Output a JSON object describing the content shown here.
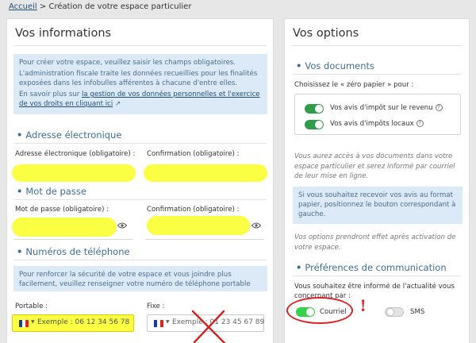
{
  "breadcrumb": {
    "home": "Accueil",
    "separator": ">",
    "current": "Création de votre espace particulier"
  },
  "left": {
    "title": "Vos informations",
    "info": {
      "p1": "Pour créer votre espace, veuillez saisir les champs obligatoires.",
      "p2": "L'administration fiscale traite les données recueillies pour les finalités exposées dans les infobulles afférentes à chacune d'entre elles.",
      "p3_prefix": "En savoir plus sur ",
      "p3_link": "la gestion de vos données personnelles et l'exercice de vos droits en cliquant ici"
    },
    "email_section": "Adresse électronique",
    "email_label": "Adresse électronique (obligatoire) :",
    "email_confirm_label": "Confirmation (obligatoire) :",
    "password_section": "Mot de passe",
    "password_label": "Mot de passe (obligatoire) :",
    "password_confirm_label": "Confirmation (obligatoire) :",
    "phone_section": "Numéros de téléphone",
    "phone_info": "Pour renforcer la sécurité de votre espace et vous joindre plus facilement, veuillez renseigner votre numéro de téléphone portable",
    "mobile_label": "Portable :",
    "mobile_placeholder": "Exemple : 06 12 34 56 78",
    "landline_label": "Fixe :",
    "landline_placeholder": "Exemple : 01 23 45 67 89"
  },
  "right": {
    "title": "Vos options",
    "docs_section": "Vos documents",
    "zero_paper": "Choisissez le « zéro papier » pour :",
    "toggle1": "Vos avis d'impôt sur le revenu",
    "toggle2": "Vos avis d'impôts locaux",
    "qmark": "?",
    "italic1": "Vous aurez accès à vos documents dans votre espace particulier et serez informé par courriel de leur mise en ligne.",
    "info": "Si vous souhaitez recevoir vos avis au format papier, positionnez le bouton correspondant à gauche.",
    "italic2": "Vos options prendront effet après activation de votre espace.",
    "pref_section": "Préférences de communication",
    "pref_text": "Vous souhaitez être informé de l'actualité vous concernant par :",
    "courriel": "Courriel",
    "sms": "SMS",
    "exclamation": "!"
  },
  "colors": {
    "accent": "#3d6e96",
    "info_bg": "#dbeaf6",
    "toggle_on": "#2e9e4b",
    "highlight": "#fbff43",
    "annotation": "#e02020"
  }
}
